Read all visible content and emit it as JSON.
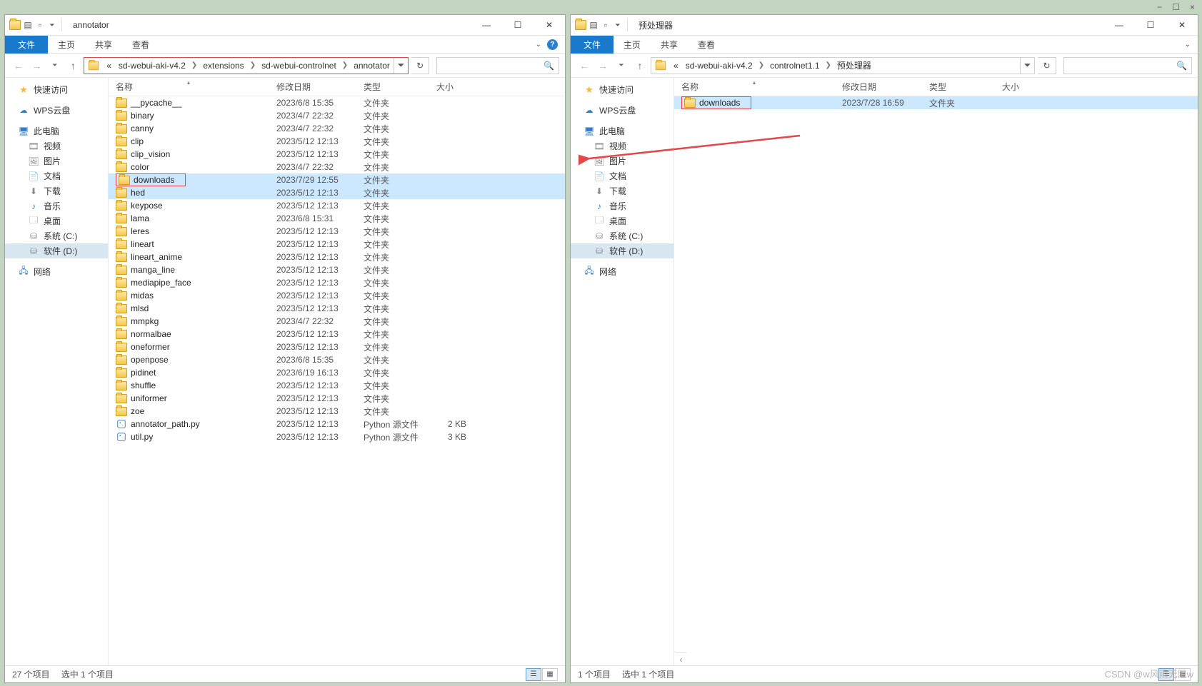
{
  "outer_window_controls": {
    "min": "−",
    "max": "☐",
    "close": "×"
  },
  "exp1": {
    "title": "annotator",
    "tabs": {
      "file": "文件",
      "home": "主页",
      "share": "共享",
      "view": "查看"
    },
    "breadcrumb": [
      "«",
      "sd-webui-aki-v4.2",
      "extensions",
      "sd-webui-controlnet",
      "annotator"
    ],
    "columns": {
      "name": "名称",
      "date": "修改日期",
      "type": "类型",
      "size": "大小"
    },
    "status": {
      "count": "27 个项目",
      "sel": "选中 1 个项目"
    },
    "nav": {
      "quick": "快速访问",
      "wps": "WPS云盘",
      "pc": "此电脑",
      "video": "视频",
      "pics": "图片",
      "docs": "文档",
      "downloads": "下载",
      "music": "音乐",
      "desktop": "桌面",
      "sysC": "系统 (C:)",
      "softD": "软件 (D:)",
      "net": "网络"
    },
    "files": [
      {
        "n": "__pycache__",
        "d": "2023/6/8 15:35",
        "t": "文件夹",
        "s": "",
        "i": "folder"
      },
      {
        "n": "binary",
        "d": "2023/4/7 22:32",
        "t": "文件夹",
        "s": "",
        "i": "folder"
      },
      {
        "n": "canny",
        "d": "2023/4/7 22:32",
        "t": "文件夹",
        "s": "",
        "i": "folder"
      },
      {
        "n": "clip",
        "d": "2023/5/12 12:13",
        "t": "文件夹",
        "s": "",
        "i": "folder"
      },
      {
        "n": "clip_vision",
        "d": "2023/5/12 12:13",
        "t": "文件夹",
        "s": "",
        "i": "folder"
      },
      {
        "n": "color",
        "d": "2023/4/7 22:32",
        "t": "文件夹",
        "s": "",
        "i": "folder"
      },
      {
        "n": "downloads",
        "d": "2023/7/29 12:55",
        "t": "文件夹",
        "s": "",
        "i": "folder",
        "sel": true,
        "box": true
      },
      {
        "n": "hed",
        "d": "2023/5/12 12:13",
        "t": "文件夹",
        "s": "",
        "i": "folder",
        "sel": true
      },
      {
        "n": "keypose",
        "d": "2023/5/12 12:13",
        "t": "文件夹",
        "s": "",
        "i": "folder"
      },
      {
        "n": "lama",
        "d": "2023/6/8 15:31",
        "t": "文件夹",
        "s": "",
        "i": "folder"
      },
      {
        "n": "leres",
        "d": "2023/5/12 12:13",
        "t": "文件夹",
        "s": "",
        "i": "folder"
      },
      {
        "n": "lineart",
        "d": "2023/5/12 12:13",
        "t": "文件夹",
        "s": "",
        "i": "folder"
      },
      {
        "n": "lineart_anime",
        "d": "2023/5/12 12:13",
        "t": "文件夹",
        "s": "",
        "i": "folder"
      },
      {
        "n": "manga_line",
        "d": "2023/5/12 12:13",
        "t": "文件夹",
        "s": "",
        "i": "folder"
      },
      {
        "n": "mediapipe_face",
        "d": "2023/5/12 12:13",
        "t": "文件夹",
        "s": "",
        "i": "folder"
      },
      {
        "n": "midas",
        "d": "2023/5/12 12:13",
        "t": "文件夹",
        "s": "",
        "i": "folder"
      },
      {
        "n": "mlsd",
        "d": "2023/5/12 12:13",
        "t": "文件夹",
        "s": "",
        "i": "folder"
      },
      {
        "n": "mmpkg",
        "d": "2023/4/7 22:32",
        "t": "文件夹",
        "s": "",
        "i": "folder"
      },
      {
        "n": "normalbae",
        "d": "2023/5/12 12:13",
        "t": "文件夹",
        "s": "",
        "i": "folder"
      },
      {
        "n": "oneformer",
        "d": "2023/5/12 12:13",
        "t": "文件夹",
        "s": "",
        "i": "folder"
      },
      {
        "n": "openpose",
        "d": "2023/6/8 15:35",
        "t": "文件夹",
        "s": "",
        "i": "folder"
      },
      {
        "n": "pidinet",
        "d": "2023/6/19 16:13",
        "t": "文件夹",
        "s": "",
        "i": "folder"
      },
      {
        "n": "shuffle",
        "d": "2023/5/12 12:13",
        "t": "文件夹",
        "s": "",
        "i": "folder"
      },
      {
        "n": "uniformer",
        "d": "2023/5/12 12:13",
        "t": "文件夹",
        "s": "",
        "i": "folder"
      },
      {
        "n": "zoe",
        "d": "2023/5/12 12:13",
        "t": "文件夹",
        "s": "",
        "i": "folder"
      },
      {
        "n": "annotator_path.py",
        "d": "2023/5/12 12:13",
        "t": "Python 源文件",
        "s": "2 KB",
        "i": "py"
      },
      {
        "n": "util.py",
        "d": "2023/5/12 12:13",
        "t": "Python 源文件",
        "s": "3 KB",
        "i": "py"
      }
    ]
  },
  "exp2": {
    "title": "预处理器",
    "tabs": {
      "file": "文件",
      "home": "主页",
      "share": "共享",
      "view": "查看"
    },
    "breadcrumb": [
      "«",
      "sd-webui-aki-v4.2",
      "controlnet1.1",
      "预处理器"
    ],
    "columns": {
      "name": "名称",
      "date": "修改日期",
      "type": "类型",
      "size": "大小"
    },
    "status": {
      "count": "1 个项目",
      "sel": "选中 1 个项目"
    },
    "nav": {
      "quick": "快速访问",
      "wps": "WPS云盘",
      "pc": "此电脑",
      "video": "视频",
      "pics": "图片",
      "docs": "文档",
      "downloads": "下载",
      "music": "音乐",
      "desktop": "桌面",
      "sysC": "系统 (C:)",
      "softD": "软件 (D:)",
      "net": "网络"
    },
    "files": [
      {
        "n": "downloads",
        "d": "2023/7/28 16:59",
        "t": "文件夹",
        "s": "",
        "i": "folder",
        "sel": true,
        "box": true
      }
    ]
  },
  "watermark": "CSDN @w风雨无阻w"
}
